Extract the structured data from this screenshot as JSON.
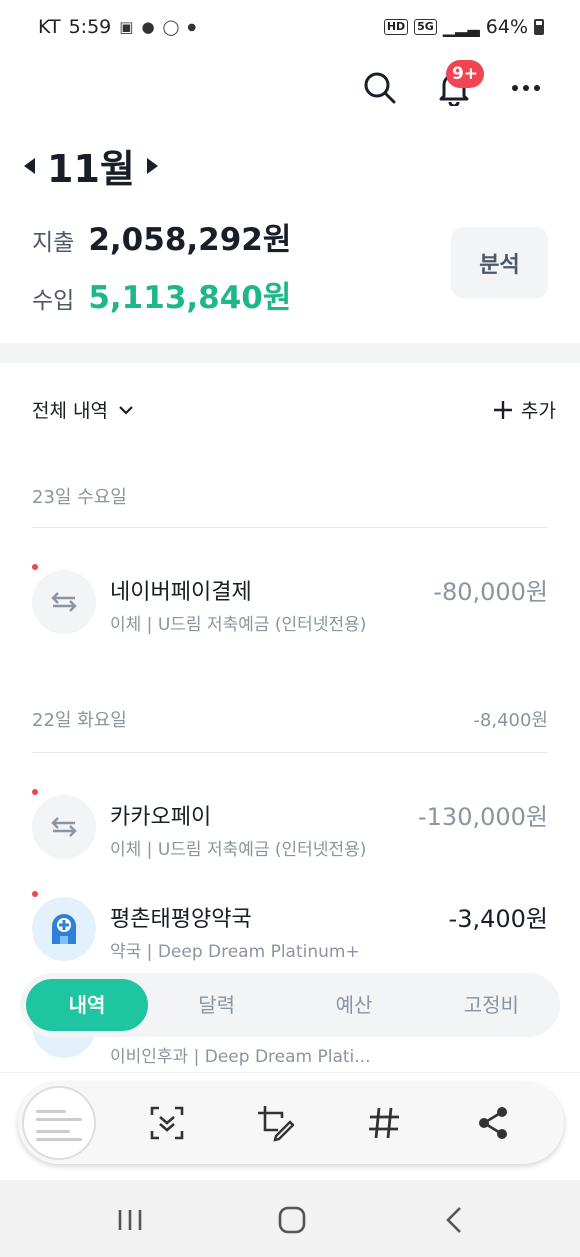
{
  "status": {
    "carrier": "KT",
    "time": "5:59",
    "battery": "64%",
    "hd": "HD",
    "net": "5G"
  },
  "header": {
    "notification_badge": "9+"
  },
  "month": {
    "label": "11월"
  },
  "summary": {
    "expense_label": "지출",
    "expense_value": "2,058,292원",
    "income_label": "수입",
    "income_value": "5,113,840원",
    "analysis_label": "분석"
  },
  "list": {
    "filter_label": "전체 내역",
    "add_label": "추가"
  },
  "days": [
    {
      "label": "23일 수요일",
      "total": ""
    },
    {
      "label": "22일 화요일",
      "total": "-8,400원"
    }
  ],
  "transactions": [
    {
      "name": "네이버페이결제",
      "sub": "이체 | U드림 저축예금 (인터넷전용)",
      "amount": "-80,000원"
    },
    {
      "name": "카카오페이",
      "sub": "이체 | U드림 저축예금 (인터넷전용)",
      "amount": "-130,000원"
    },
    {
      "name": "평촌태평양약국",
      "sub": "약국 | Deep Dream Platinum+",
      "amount": "-3,400원"
    }
  ],
  "partial": {
    "sub": "이비인후과 | Deep Dream Plati..."
  },
  "tabs": [
    "내역",
    "달력",
    "예산",
    "고정비"
  ],
  "colors": {
    "accent": "#1fc5a0",
    "income": "#1fb78a",
    "badge": "#f04452"
  }
}
